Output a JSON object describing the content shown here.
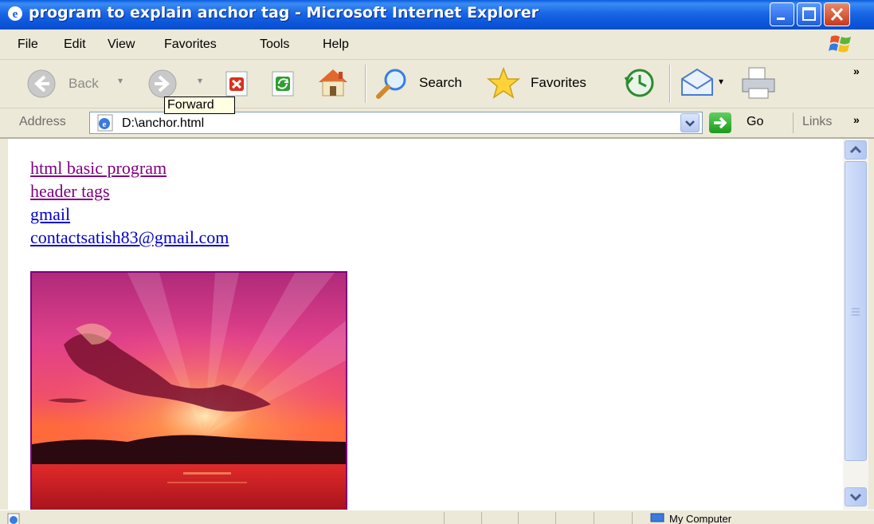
{
  "window": {
    "title": "program to explain anchor tag - Microsoft Internet Explorer"
  },
  "menu": {
    "items": [
      "File",
      "Edit",
      "View",
      "Favorites",
      "Tools",
      "Help"
    ]
  },
  "toolbar": {
    "back_label": "Back",
    "search_label": "Search",
    "favorites_label": "Favorites",
    "tooltip": "Forward",
    "more_chevron": "»"
  },
  "address": {
    "label": "Address",
    "value": "D:\\anchor.html",
    "go_label": "Go",
    "links_label": "Links",
    "links_chevron": "»"
  },
  "content": {
    "links": [
      {
        "text": "html basic program",
        "state": "visited"
      },
      {
        "text": "header tags",
        "state": "visited"
      },
      {
        "text": "gmail",
        "state": "unvisited"
      },
      {
        "text": "contactsatish83@gmail.com",
        "state": "unvisited"
      }
    ]
  },
  "status": {
    "zone": "My Computer"
  },
  "colors": {
    "titlebar": "#0a5ddf",
    "visited_link": "#800080",
    "unvisited_link": "#0000cc"
  },
  "icons": [
    "ie-icon",
    "minimize-icon",
    "maximize-icon",
    "close-icon",
    "windows-logo-icon",
    "back-icon",
    "forward-icon",
    "stop-icon",
    "refresh-icon",
    "home-icon",
    "search-icon",
    "favorites-star-icon",
    "history-icon",
    "mail-icon",
    "print-icon",
    "go-arrow-icon"
  ]
}
